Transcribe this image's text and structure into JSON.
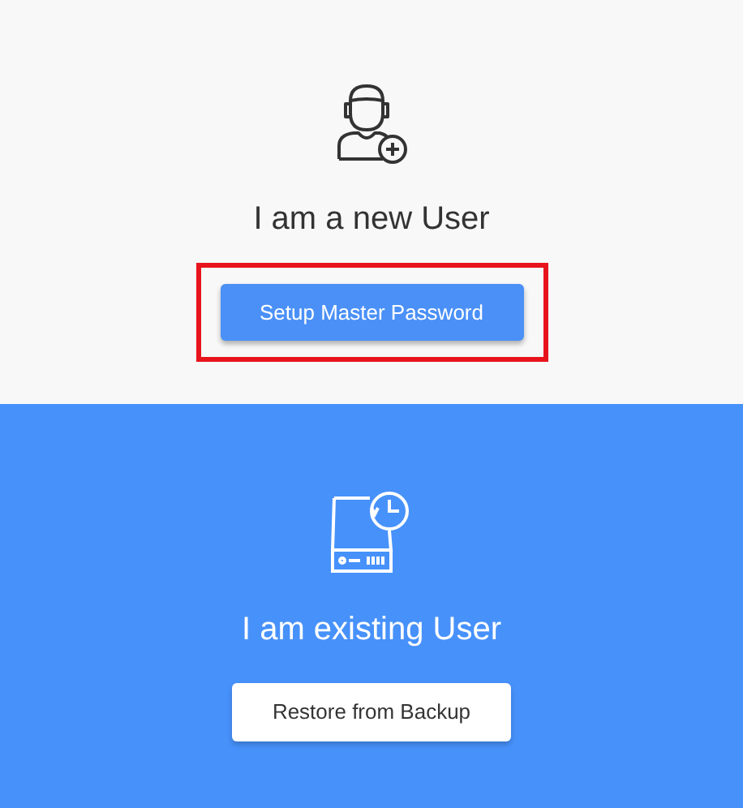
{
  "new_user": {
    "title": "I am a new User",
    "button": {
      "label": "Setup Master Password",
      "highlighted": true
    }
  },
  "existing_user": {
    "title": "I am existing User",
    "button": {
      "label": "Restore from Backup",
      "highlighted": false
    }
  }
}
